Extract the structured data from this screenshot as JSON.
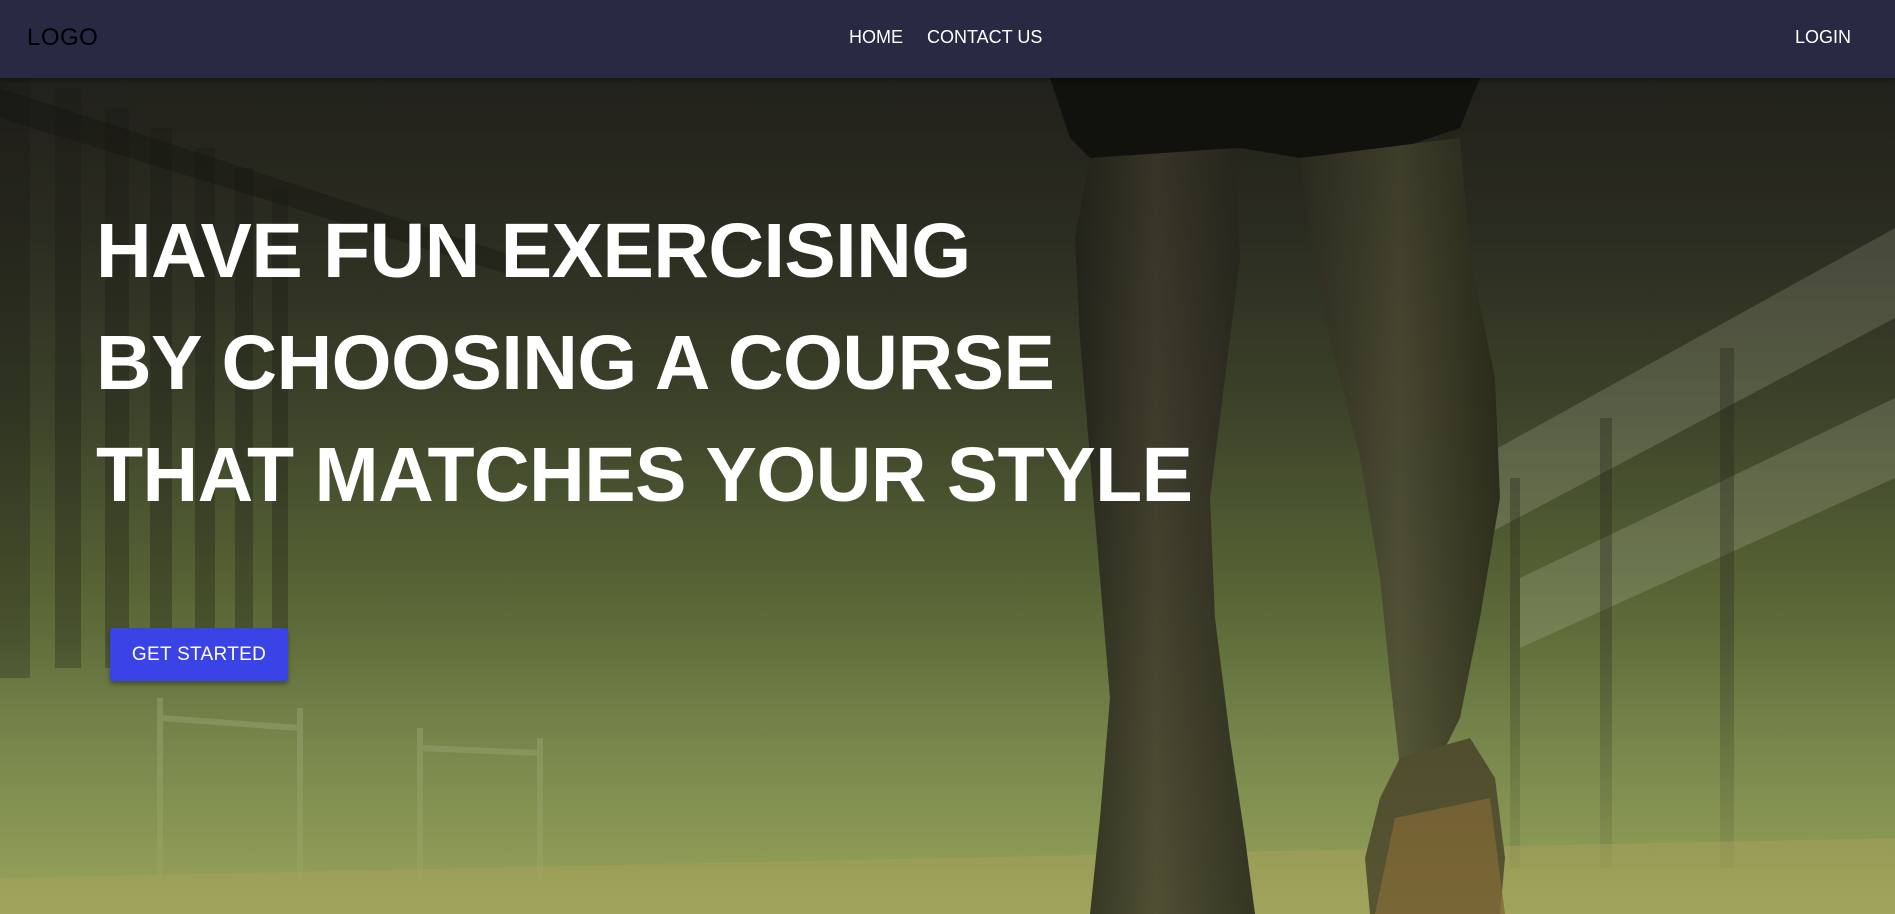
{
  "navbar": {
    "logo": "LOGO",
    "links": [
      {
        "label": "HOME"
      },
      {
        "label": "CONTACT US"
      }
    ],
    "login_label": "LOGIN"
  },
  "hero": {
    "title_lines": [
      "HAVE FUN EXERCISING",
      "BY CHOOSING A COURSE",
      "THAT MATCHES YOUR STYLE"
    ],
    "cta_label": "GET STARTED"
  },
  "colors": {
    "navbar_bg": "#282a44",
    "cta_bg": "#3a44e6",
    "text_light": "#ffffff"
  }
}
